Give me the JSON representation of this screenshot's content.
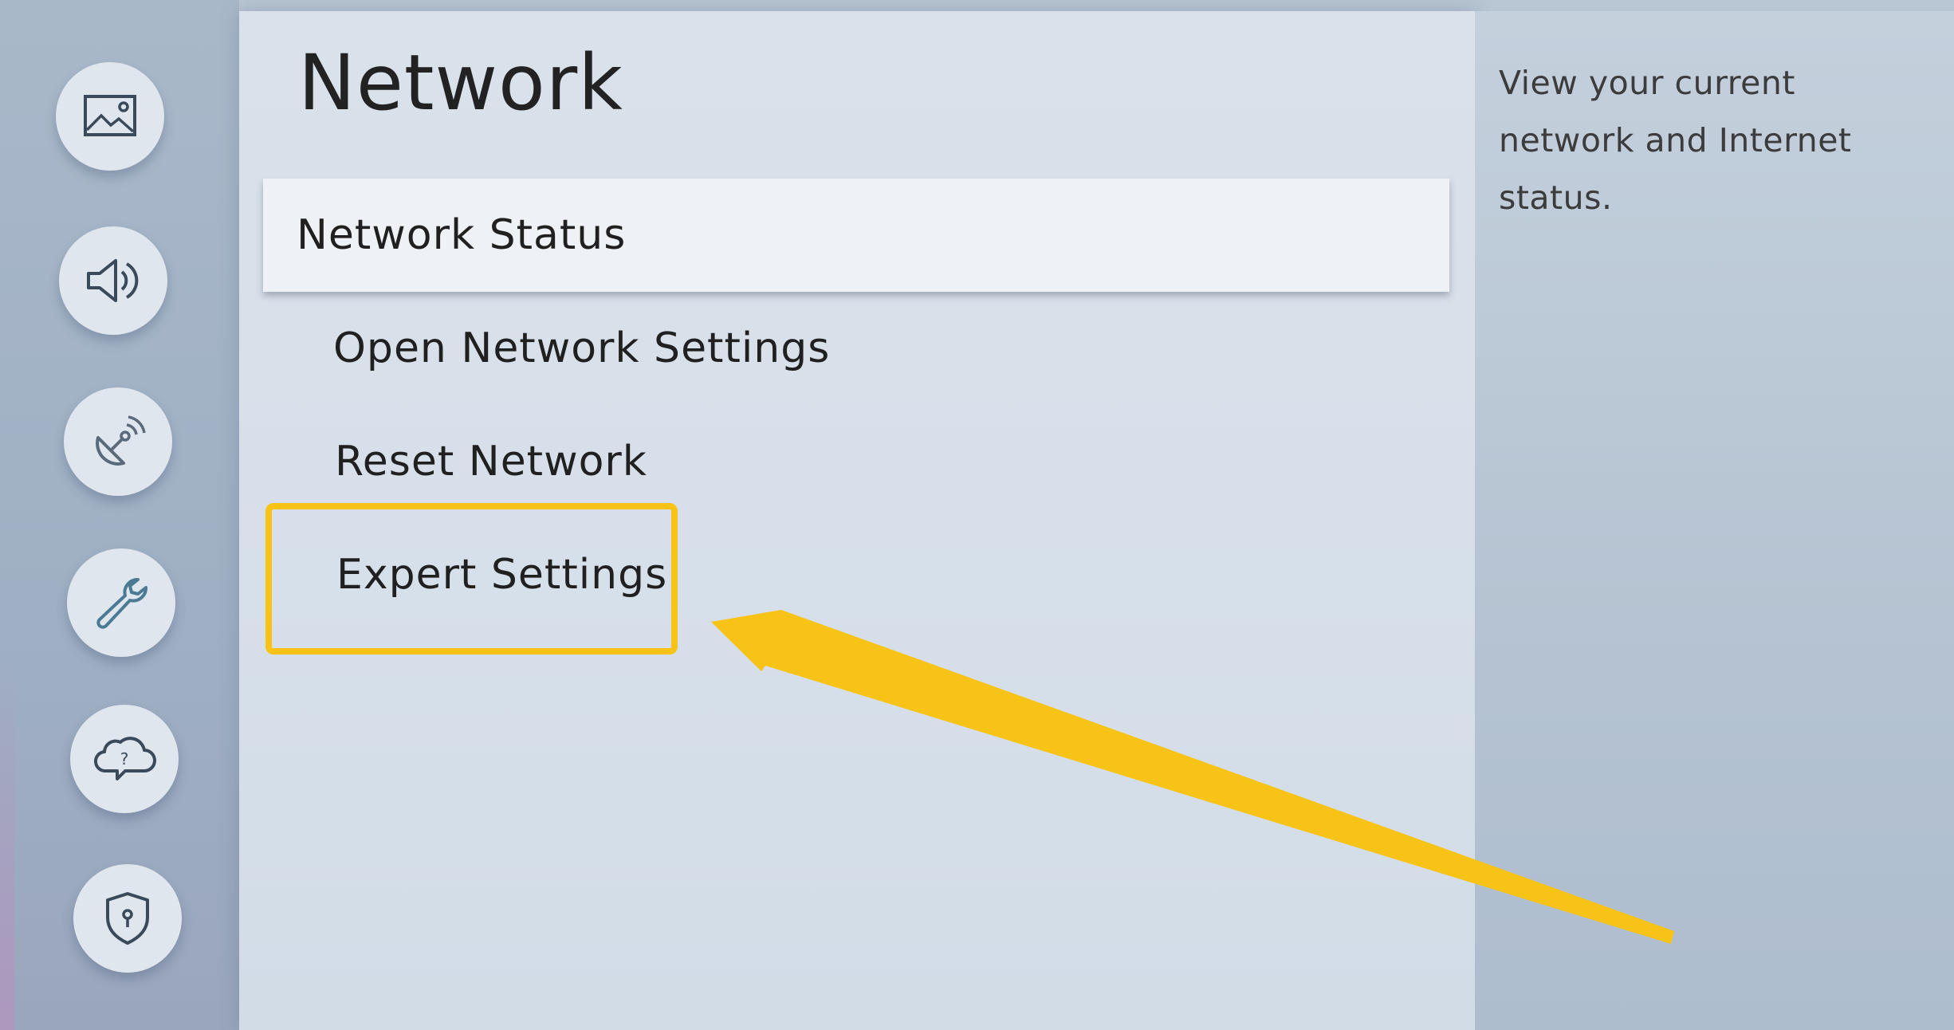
{
  "header": {
    "title": "Network"
  },
  "menu": {
    "items": [
      {
        "label": "Network Status",
        "selected": true
      },
      {
        "label": "Open Network Settings",
        "selected": false
      },
      {
        "label": "Reset Network",
        "selected": false
      },
      {
        "label": "Expert Settings",
        "selected": false,
        "highlighted": true
      }
    ]
  },
  "description": {
    "text": "View your current network and Internet status."
  },
  "sidebar": {
    "icons": [
      {
        "name": "picture-icon"
      },
      {
        "name": "sound-icon"
      },
      {
        "name": "broadcasting-icon"
      },
      {
        "name": "wrench-icon",
        "active": true
      },
      {
        "name": "support-cloud-icon"
      },
      {
        "name": "privacy-shield-icon"
      }
    ]
  },
  "annotation": {
    "highlight_color": "#f7c316",
    "arrow_color": "#f7c316"
  }
}
